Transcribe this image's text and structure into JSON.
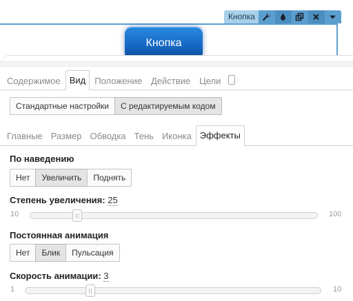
{
  "toolbar": {
    "title": "Кнопка",
    "icons": [
      "wrench-icon",
      "drop-icon",
      "duplicate-icon",
      "close-icon",
      "chevron-down-icon"
    ]
  },
  "canvas": {
    "button_label": "Кнопка",
    "button_color": "#1669c4"
  },
  "tabs": [
    "Содержимое",
    "Вид",
    "Положение",
    "Действие",
    "Цели"
  ],
  "active_tab": "Вид",
  "mode": {
    "options": [
      "Стандартные настройки",
      "С редактируемым кодом"
    ],
    "active": "С редактируемым кодом"
  },
  "subtabs": [
    "Главные",
    "Размер",
    "Обводка",
    "Тень",
    "Иконка",
    "Эффекты"
  ],
  "active_subtab": "Эффекты",
  "hover": {
    "label": "По наведению",
    "options": [
      "Нет",
      "Увеличить",
      "Поднять"
    ],
    "active": "Увеличить"
  },
  "scale": {
    "label": "Степень увеличения",
    "value": "25",
    "min": "10",
    "max": "100",
    "level": 25
  },
  "animation": {
    "label": "Постоянная анимация",
    "options": [
      "Нет",
      "Блик",
      "Пульсация"
    ],
    "active": "Блик"
  },
  "speed": {
    "label": "Скорость анимации",
    "value": "3",
    "min": "1",
    "max": "10",
    "level": 3
  },
  "colors": {
    "accent": "#5b9fcf",
    "toolbar_title_bg": "#a9d0ea"
  }
}
